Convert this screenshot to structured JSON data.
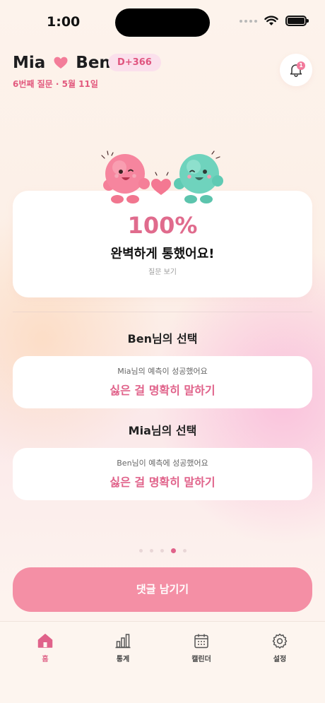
{
  "status_bar": {
    "time": "1:00"
  },
  "header": {
    "name_left": "Mia",
    "name_right": "Ben",
    "dday": "D+366",
    "subinfo": "6번째 질문 · 5월 11일",
    "notification_count": "1"
  },
  "result": {
    "percent": "100%",
    "title": "완벽하게 통했어요!",
    "view_question": "질문 보기"
  },
  "choices": [
    {
      "title": "Ben님의 선택",
      "subtitle": "Mia님의 예측이 성공했어요",
      "answer": "싫은 걸 명확히 말하기"
    },
    {
      "title": "Mia님의 선택",
      "subtitle": "Ben님이 예측에 성공했어요",
      "answer": "싫은 걸 명확히 말하기"
    }
  ],
  "pagination": {
    "count": 5,
    "active_index": 3
  },
  "comment_button": "댓글 남기기",
  "tabs": [
    {
      "label": "홈",
      "icon": "home-icon",
      "active": true
    },
    {
      "label": "통계",
      "icon": "chart-icon",
      "active": false
    },
    {
      "label": "캘린더",
      "icon": "calendar-icon",
      "active": false
    },
    {
      "label": "설정",
      "icon": "gear-icon",
      "active": false
    }
  ],
  "colors": {
    "accent": "#e0628a",
    "button": "#f48fa5",
    "badge_bg": "#fbe0ec",
    "mascot_pink": "#f6859e",
    "mascot_mint": "#6fd3bd"
  }
}
